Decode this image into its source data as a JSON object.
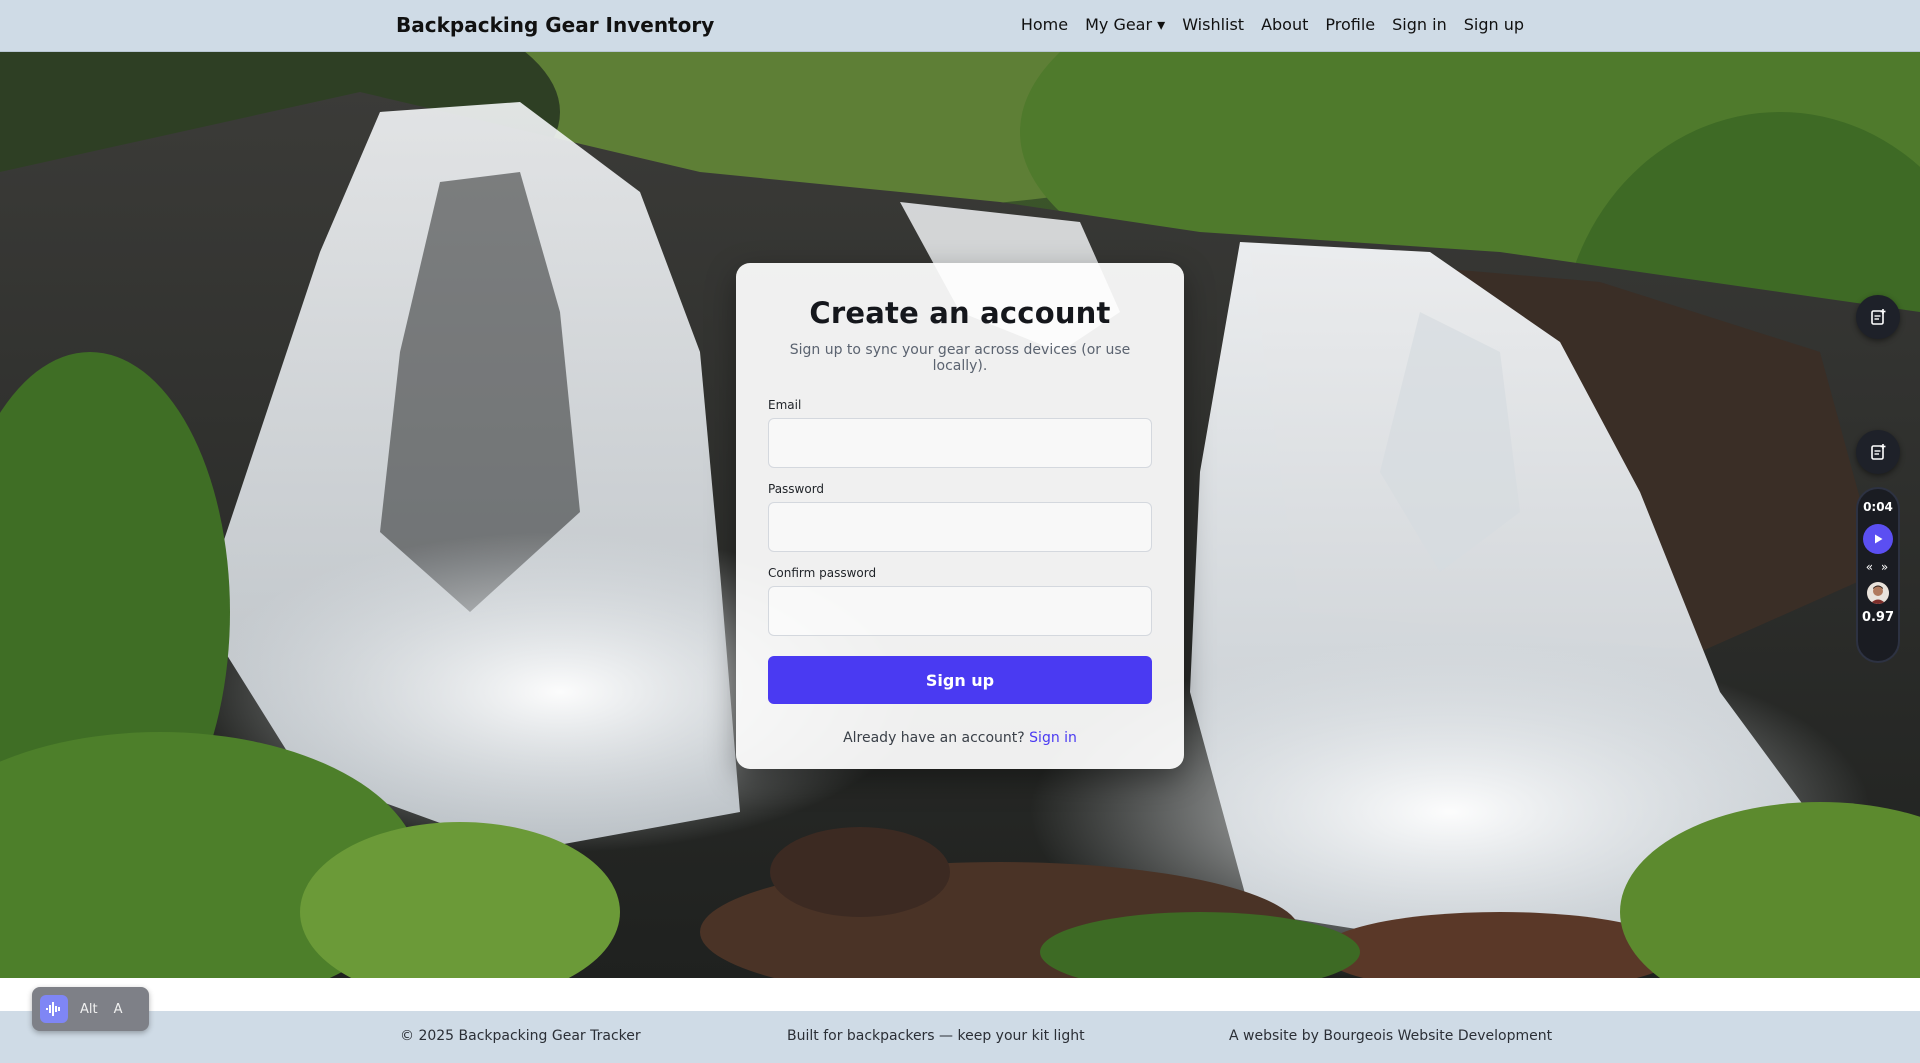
{
  "navbar": {
    "brand": "Backpacking Gear Inventory",
    "links": {
      "home": "Home",
      "my_gear": "My Gear ▾",
      "wishlist": "Wishlist",
      "about": "About",
      "profile": "Profile",
      "sign_in": "Sign in",
      "sign_up": "Sign up"
    }
  },
  "signup_card": {
    "title": "Create an account",
    "subtitle": "Sign up to sync your gear across devices (or use locally).",
    "email_label": "Email",
    "email_value": "",
    "password_label": "Password",
    "password_value": "",
    "confirm_label": "Confirm password",
    "confirm_value": "",
    "submit_label": "Sign up",
    "signin_prompt": "Already have an account?",
    "signin_link": "Sign in"
  },
  "player": {
    "time": "0:04",
    "skip": "« »",
    "speed": "0.97"
  },
  "footer": {
    "copyright": "© 2025 Backpacking Gear Tracker",
    "tagline": "Built for backpackers — keep your kit light",
    "credit": "A website by Bourgeois Website Development"
  },
  "a11y_toolbar": {
    "alt_label": "Alt",
    "a_label": "A"
  },
  "colors": {
    "navbar_bg": "#cfdbe6",
    "accent": "#4a3af2",
    "player_bg": "#1a1c22"
  }
}
